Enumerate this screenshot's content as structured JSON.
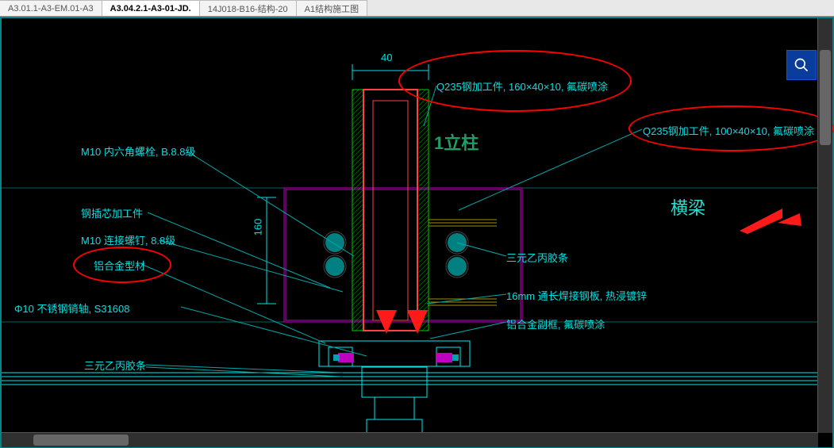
{
  "tabs": [
    {
      "label": "A3.01.1-A3-EM.01-A3",
      "active": false
    },
    {
      "label": "A3.04.2.1-A3-01-JD.",
      "active": true
    },
    {
      "label": "14J018-B16-结构-20",
      "active": false
    },
    {
      "label": "A1结构施工图",
      "active": false
    }
  ],
  "dimensions": {
    "d1": "40",
    "d2": "160"
  },
  "annotations_left": {
    "bolt_m10_hex": "M10 内六角螺栓, B.8.8级",
    "steel_core": "钢插芯加工件",
    "bolt_m10_conn": "M10 连接螺钉, 8.8级",
    "alu_profile": "铝合金型材",
    "ss_pin": "Φ10 不锈钢销轴, S31608",
    "epdm_strip": "三元乙丙胶条"
  },
  "annotations_right": {
    "q235_main": "Q235钢加工件, 160×40×10, 氟碳喷涂",
    "q235_beam": "Q235钢加工件, 100×40×10, 氟碳喷涂",
    "epdm_strip": "三元乙丙胶条",
    "welded_plate": "16mm 通长焊接钢板, 热浸镀锌",
    "alu_frame": "铝合金副框, 氟碳喷涂"
  },
  "overlays": {
    "column": "1立柱",
    "beam": "横梁"
  }
}
